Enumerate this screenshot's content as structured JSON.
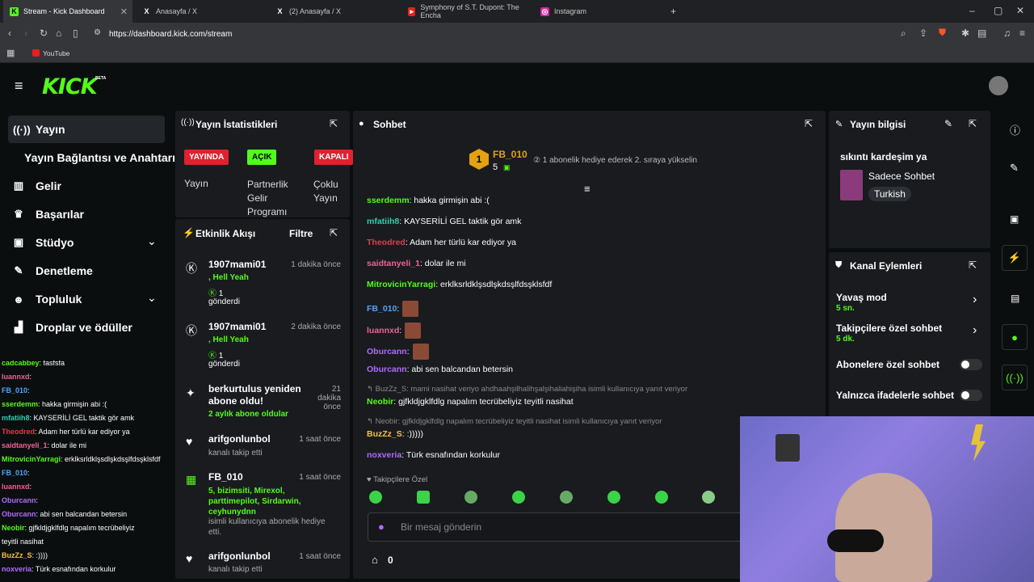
{
  "browser": {
    "tabs": [
      {
        "label": "Stream - Kick Dashboard",
        "icon": "kick-icon",
        "active": true
      },
      {
        "label": "Anasayfa / X",
        "icon": "x-icon"
      },
      {
        "label": "(2) Anasayfa / X",
        "icon": "x-icon"
      },
      {
        "label": "Symphony of S.T. Dupont: The Encha",
        "icon": "youtube-icon"
      },
      {
        "label": "Instagram",
        "icon": "instagram-icon"
      }
    ],
    "url": "https://dashboard.kick.com/stream",
    "bookmark": "YouTube"
  },
  "brand": {
    "logo": "KICK",
    "beta": "BETA"
  },
  "sidebar": {
    "items": [
      {
        "label": "Yayın",
        "icon": "broadcast-icon"
      },
      {
        "label": "Yayın Bağlantısı ve Anahtarı"
      },
      {
        "label": "Gelir",
        "icon": "chart-icon"
      },
      {
        "label": "Başarılar",
        "icon": "trophy-icon"
      },
      {
        "label": "Stüdyo",
        "icon": "studio-icon"
      },
      {
        "label": "Denetleme",
        "icon": "wrench-icon"
      },
      {
        "label": "Topluluk",
        "icon": "people-icon"
      },
      {
        "label": "Droplar ve ödüller",
        "icon": "drops-icon"
      }
    ]
  },
  "stats": {
    "title": "Yayın İstatistikleri",
    "live": "YAYINDA",
    "open": "AÇIK",
    "closed": "KAPALI",
    "l1": "Yayın",
    "l2": "Partnerlik Gelir Programı",
    "l3": "Çoklu Yayın"
  },
  "feed": {
    "title": "Etkinlik Akışı",
    "filter": "Filtre",
    "items": [
      {
        "name": "1907mami01",
        "extra": ", Hell Yeah",
        "count": "1",
        "action": "gönderdi",
        "time": "1 dakika önce"
      },
      {
        "name": "1907mami01",
        "extra": ", Hell Yeah",
        "count": "1",
        "action": "gönderdi",
        "time": "2 dakika önce"
      },
      {
        "name": "berkurtulus yeniden abone oldu!",
        "extra": "2 aylık abone oldular",
        "time": "21 dakika önce"
      },
      {
        "name": "arifgonlunbol",
        "extra": "kanalı takip etti",
        "time": "1 saat önce"
      },
      {
        "name": "FB_010",
        "extra": "5, bizimsiti, Mirexol, parttimepilot, Sirdarwin, ceyhunydnn",
        "action": "isimli kullanıcıya abonelik hediye etti.",
        "time": "1 saat önce"
      },
      {
        "name": "arifgonlunbol",
        "extra": "kanalı takip etti",
        "time": "1 saat önce"
      }
    ]
  },
  "chat": {
    "title": "Sohbet",
    "top_user": "FB_010",
    "top_rank": "1",
    "top_count": "5",
    "gift_hint": "1 abonelik hediye ederek 2. sıraya yükselin",
    "messages": [
      {
        "user": "sserdemm",
        "color": "#53fc18",
        "text": ": hakka girmişin abi :("
      },
      {
        "user": "mfatiih8",
        "color": "#2fd0b0",
        "text": ": KAYSERİLİ GEL taktik gör amk"
      },
      {
        "user": "Theodred",
        "color": "#e33b4a",
        "text": ": Adam her türlü kar ediyor ya"
      },
      {
        "user": "saidtanyeli_1",
        "color": "#f06292",
        "text": ": dolar ile mi"
      },
      {
        "user": "MitrovicinYarragi",
        "color": "#53fc18",
        "text": ": erklksrldklşsdlşkdsşlfdsşklsfdf"
      },
      {
        "user": "FB_010",
        "color": "#4ea6ff",
        "text": ":"
      },
      {
        "user": "luannxd",
        "color": "#f06292",
        "text": ":"
      },
      {
        "user": "Oburcann",
        "color": "#b06bff",
        "text": ":"
      },
      {
        "user": "Oburcann",
        "color": "#b06bff",
        "text": ": abi sen balcandan betersin"
      },
      {
        "user": "Neobir",
        "color": "#53fc18",
        "text": ": gjfkldjgklfdlg napalım tecrübeliyiz teyitli nasihat"
      },
      {
        "user": "BuzZz_S",
        "color": "#f5c242",
        "text": ": :)))))"
      },
      {
        "user": "noxveria",
        "color": "#b06bff",
        "text": ": Türk esnafından korkulur"
      }
    ],
    "reply1": "BuzZz_S: mami nasihat veriyo ahdhaahşilhalihşalşihaliahişiha isimli kullanıcıya yanıt veriyor",
    "reply2": "Neobir: gjfkldjgklfdlg napalım tecrübeliyiz teyitli nasihat isimli kullanıcıya yanıt veriyor",
    "followers_only": "Takipçilere Özel",
    "input_placeholder": "Bir mesaj gönderin",
    "store_count": "0"
  },
  "info": {
    "title": "Yayın bilgisi",
    "stream_title": "sıkıntı kardeşim ya",
    "category": "Sadece Sohbet",
    "language": "Turkish"
  },
  "actions": {
    "title": "Kanal Eylemleri",
    "slow": "Yavaş mod",
    "slow_v": "5 sn.",
    "followers": "Takipçilere özel sohbet",
    "followers_v": "5 dk.",
    "subs": "Abonelere özel sohbet",
    "emotes": "Yalnızca ifadelerle sohbet"
  },
  "overlay_chat": [
    {
      "user": "cadcabbey",
      "text": ": fasfsfa",
      "color": "#53fc18"
    },
    {
      "user": "luannxd",
      "text": ":",
      "color": "#f06292"
    },
    {
      "user": "FB_010",
      "text": ":",
      "color": "#4ea6ff"
    },
    {
      "user": "sserdemm",
      "text": ": hakka girmişin abi :(",
      "color": "#53fc18"
    },
    {
      "user": "mfatiih8",
      "text": ": KAYSERİLİ GEL taktik gör amk",
      "color": "#2fd0b0"
    },
    {
      "user": "Theodred",
      "text": ": Adam her türlü kar ediyor ya",
      "color": "#e33b4a"
    },
    {
      "user": "saidtanyeli_1",
      "text": ": dolar ile mi",
      "color": "#f06292"
    },
    {
      "user": "MitrovicinYarragi",
      "text": ": erklksrldklşsdlşkdsşlfdsşklsfdf",
      "color": "#53fc18"
    },
    {
      "user": "FB_010",
      "text": ":",
      "color": "#4ea6ff"
    },
    {
      "user": "luannxd",
      "text": ":",
      "color": "#f06292"
    },
    {
      "user": "Oburcann",
      "text": ":",
      "color": "#b06bff"
    },
    {
      "user": "Oburcann",
      "text": ": abi sen balcandan betersin",
      "color": "#b06bff"
    },
    {
      "user": "Neobir",
      "text": ": gjfkldjgklfdlg napalım tecrübeliyiz",
      "color": "#53fc18"
    },
    {
      "user": "",
      "text": "teyitli nasihat",
      "color": "#fff"
    },
    {
      "user": "BuzZz_S",
      "text": ": :))))",
      "color": "#f5c242"
    },
    {
      "user": "noxveria",
      "text": ": Türk esnafından korkulur",
      "color": "#b06bff"
    }
  ]
}
